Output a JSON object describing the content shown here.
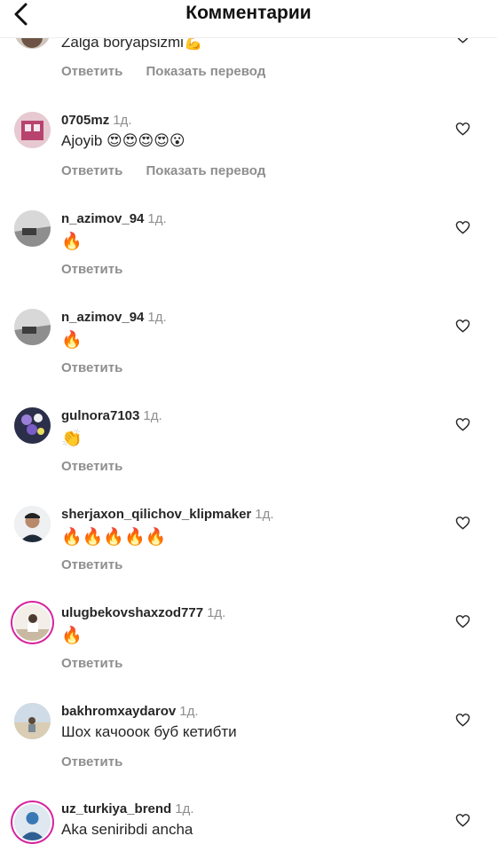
{
  "header": {
    "title": "Комментарии"
  },
  "comments": [
    {
      "user": "",
      "time": "",
      "text": "Zalga boryapsizmi💪",
      "reply": "Ответить",
      "translate": "Показать перевод"
    },
    {
      "user": "0705mz",
      "time": "1д.",
      "text": "Ajoyib 😍😍😍😍😮",
      "reply": "Ответить",
      "translate": "Показать перевод"
    },
    {
      "user": "n_azimov_94",
      "time": "1д.",
      "text": "🔥",
      "reply": "Ответить"
    },
    {
      "user": "n_azimov_94",
      "time": "1д.",
      "text": "🔥",
      "reply": "Ответить"
    },
    {
      "user": "gulnora7103",
      "time": "1д.",
      "text": "👏",
      "reply": "Ответить"
    },
    {
      "user": "sherjaxon_qilichov_klipmaker",
      "time": "1д.",
      "text": "🔥🔥🔥🔥🔥",
      "reply": "Ответить"
    },
    {
      "user": "ulugbekovshaxzod777",
      "time": "1д.",
      "text": "🔥",
      "reply": "Ответить"
    },
    {
      "user": "bakhromxaydarov",
      "time": "1д.",
      "text": "Шох качооок буб кетибти",
      "reply": "Ответить"
    },
    {
      "user": "uz_turkiya_brend",
      "time": "1д.",
      "text": "Aka seniribdi ancha",
      "reply": ""
    }
  ],
  "icons": {
    "back": "chevron-left-icon",
    "like": "heart-outline-icon"
  }
}
